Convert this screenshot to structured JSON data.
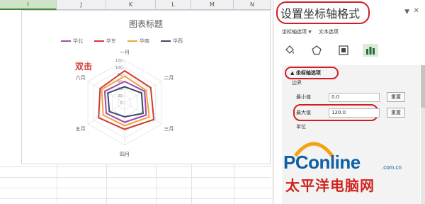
{
  "sheet": {
    "columns": [
      "I",
      "J",
      "K",
      "L",
      "M",
      "N"
    ],
    "selected_column": "I"
  },
  "chart": {
    "title": "图表标题",
    "annotation": "双击"
  },
  "chart_data": {
    "type": "radar",
    "title": "图表标题",
    "categories": [
      "一月",
      "二月",
      "三月",
      "四月",
      "五月",
      "六月"
    ],
    "ticks": [
      "120",
      "100",
      "80",
      "60",
      "40",
      "20",
      "0"
    ],
    "rmax": 120,
    "series": [
      {
        "name": "华北",
        "color": "#a24ab0",
        "values": [
          60,
          65,
          70,
          55,
          60,
          65
        ]
      },
      {
        "name": "华东",
        "color": "#d23c32",
        "values": [
          90,
          85,
          95,
          75,
          85,
          80
        ]
      },
      {
        "name": "华南",
        "color": "#f0a33a",
        "values": [
          75,
          70,
          80,
          65,
          70,
          75
        ]
      },
      {
        "name": "华西",
        "color": "#3c4a6b",
        "values": [
          45,
          55,
          60,
          40,
          50,
          55
        ]
      }
    ],
    "legend_position": "top"
  },
  "pane": {
    "title": "设置坐标轴格式",
    "dropdown_icon": "chevron-down",
    "close_icon": "close",
    "tabs": {
      "axis_options": "坐标轴选项",
      "text_options": "文本选项"
    },
    "icons": [
      "fill-icon",
      "pentagon-icon",
      "size-icon",
      "bar-chart-icon"
    ],
    "section_title": "坐标轴选项",
    "bounds_label": "边界",
    "min_label": "最小值",
    "min_value": "0.0",
    "max_label": "最大值",
    "max_value": "120.0",
    "reset_label": "重置",
    "units_label": "单位"
  },
  "logo": {
    "main": "PConline",
    "domain": ".com.cn",
    "chinese": "太平洋电脑网"
  }
}
